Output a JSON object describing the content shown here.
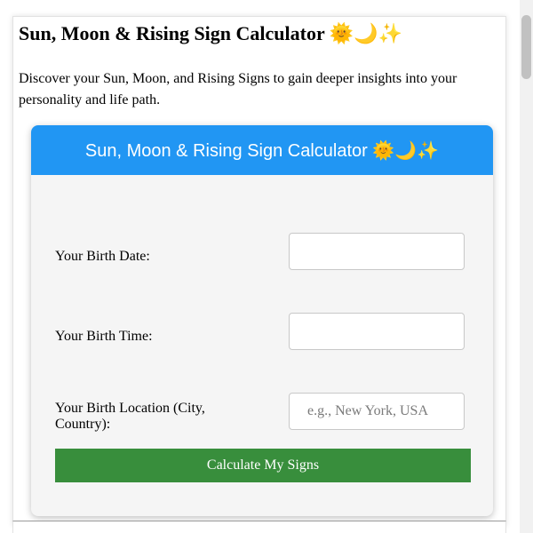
{
  "page": {
    "title": "Sun, Moon & Rising Sign Calculator 🌞🌙✨",
    "intro": "Discover your Sun, Moon, and Rising Signs to gain deeper insights into your personality and life path."
  },
  "calculator": {
    "title": "Sun, Moon & Rising Sign Calculator 🌞🌙✨",
    "fields": [
      {
        "label": "Your Birth Date:",
        "value": "",
        "placeholder": ""
      },
      {
        "label": "Your Birth Time:",
        "value": "",
        "placeholder": ""
      },
      {
        "label": "Your Birth Location (City, Country):",
        "value": "",
        "placeholder": "e.g., New York, USA"
      }
    ],
    "button_label": "Calculate My Signs"
  },
  "colors": {
    "header": "#2196f3",
    "button": "#388e3c",
    "panel": "#f5f5f5"
  }
}
